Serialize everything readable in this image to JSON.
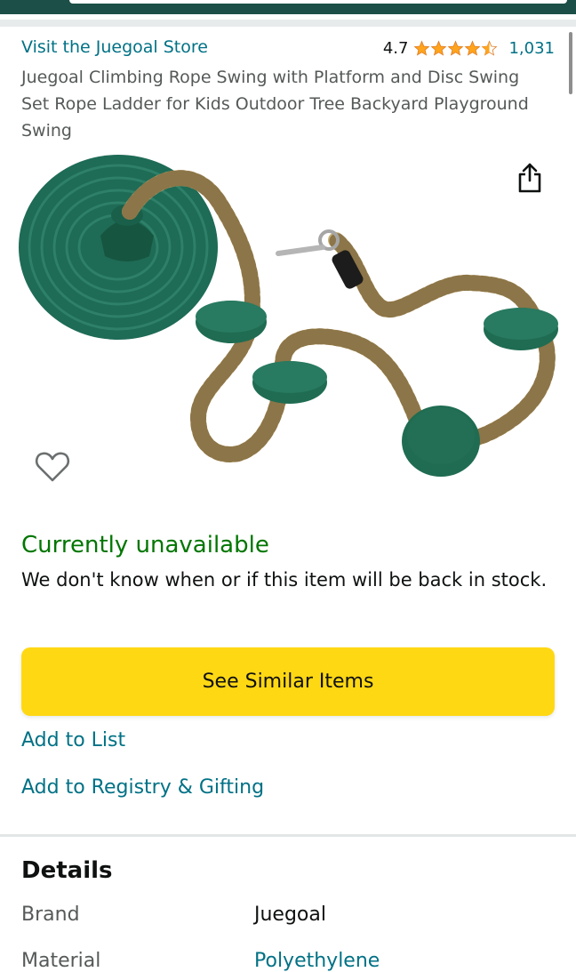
{
  "store": {
    "link_text": "Visit the Juegoal Store"
  },
  "rating": {
    "score": "4.7",
    "stars": 4.5,
    "star_color": "#ffa41c",
    "count": "1,031"
  },
  "product": {
    "title": "Juegoal Climbing Rope Swing with Platform and Disc Swing Set Rope Ladder for Kids Outdoor Tree Backyard Playground Swing",
    "image_icon": "product-photo",
    "share_icon": "share-icon",
    "favorite_icon": "heart-icon"
  },
  "availability": {
    "status": "Currently unavailable",
    "status_color": "#007600",
    "message": "We don't know when or if this item will be back in stock."
  },
  "actions": {
    "see_similar": "See Similar Items",
    "see_similar_color": "#ffd814",
    "add_to_list": "Add to List",
    "add_to_registry": "Add to Registry & Gifting"
  },
  "details": {
    "heading": "Details",
    "rows": [
      {
        "key": "Brand",
        "value": "Juegoal"
      },
      {
        "key": "Material",
        "value": "Polyethylene"
      }
    ]
  },
  "colors": {
    "header_green": "#1b4f47",
    "link_teal": "#007185"
  }
}
